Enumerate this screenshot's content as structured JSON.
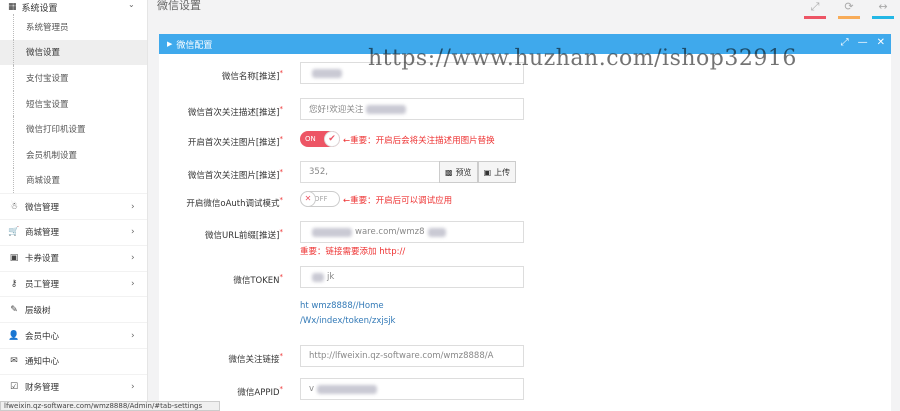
{
  "sidebar": {
    "section_title": "系统设置",
    "sub_items": [
      {
        "label": "系统管理员",
        "active": false
      },
      {
        "label": "微信设置",
        "active": true
      },
      {
        "label": "支付宝设置",
        "active": false
      },
      {
        "label": "短信宝设置",
        "active": false
      },
      {
        "label": "微信打印机设置",
        "active": false
      },
      {
        "label": "会员机制设置",
        "active": false
      },
      {
        "label": "商城设置",
        "active": false
      }
    ],
    "items": [
      {
        "label": "微信管理",
        "icon": "☃",
        "icon_name": "snowman-icon",
        "arrow": true
      },
      {
        "label": "商城管理",
        "icon": "🛒",
        "icon_name": "cart-icon",
        "arrow": true
      },
      {
        "label": "卡券设置",
        "icon": "▣",
        "icon_name": "ticket-icon",
        "arrow": true
      },
      {
        "label": "员工管理",
        "icon": "⚷",
        "icon_name": "sitemap-icon",
        "arrow": true
      },
      {
        "label": "层级树",
        "icon": "✎",
        "icon_name": "pin-icon",
        "arrow": false
      },
      {
        "label": "会员中心",
        "icon": "👤",
        "icon_name": "user-icon",
        "arrow": true
      },
      {
        "label": "通知中心",
        "icon": "✉",
        "icon_name": "envelope-icon",
        "arrow": false
      },
      {
        "label": "财务管理",
        "icon": "☑",
        "icon_name": "checkbox-icon",
        "arrow": true
      }
    ]
  },
  "header": {
    "page_title": "微信设置"
  },
  "panel": {
    "title": "微信配置",
    "watermark": "https://www.huzhan.com/ishop32916"
  },
  "form": {
    "name_label": "微信名称[推送]",
    "follow_desc_label": "微信首次关注描述[推送]",
    "follow_desc_value": "您好!欢迎关注",
    "open_image_label": "开启首次关注图片[推送]",
    "open_image_toggle": "ON",
    "open_image_hint": "←重要：开启后会将关注描述用图片替换",
    "image_label": "微信首次关注图片[推送]",
    "image_value": "352,",
    "preview_button": "预览",
    "upload_button": "上传",
    "oauth_label": "开启微信oAuth调试模式",
    "oauth_toggle": "OFF",
    "oauth_hint": "←重要：开启后可以调试应用",
    "url_label": "微信URL前缀[推送]",
    "url_value": "ware.com/wmz8",
    "url_note": "重要：链接需要添加 http://",
    "token_label": "微信TOKEN",
    "token_value": "jk",
    "token_link_line1": "ht                          wmz8888//Home",
    "token_link_line2": "/Wx/index/token/zxjsjk",
    "follow_link_label": "微信关注链接",
    "follow_link_value": "http://lfweixin.qz-software.com/wmz8888/A",
    "appid_label": "微信APPID",
    "appid_value": "v"
  },
  "statusbar": {
    "text": "lfweixin.qz-software.com/wmz8888/Admin/#tab-settings"
  },
  "colors": {
    "panel_header": "#3fa9ec",
    "toggle_on": "#ed5565",
    "required": "#e33333",
    "link": "#337ab7"
  }
}
